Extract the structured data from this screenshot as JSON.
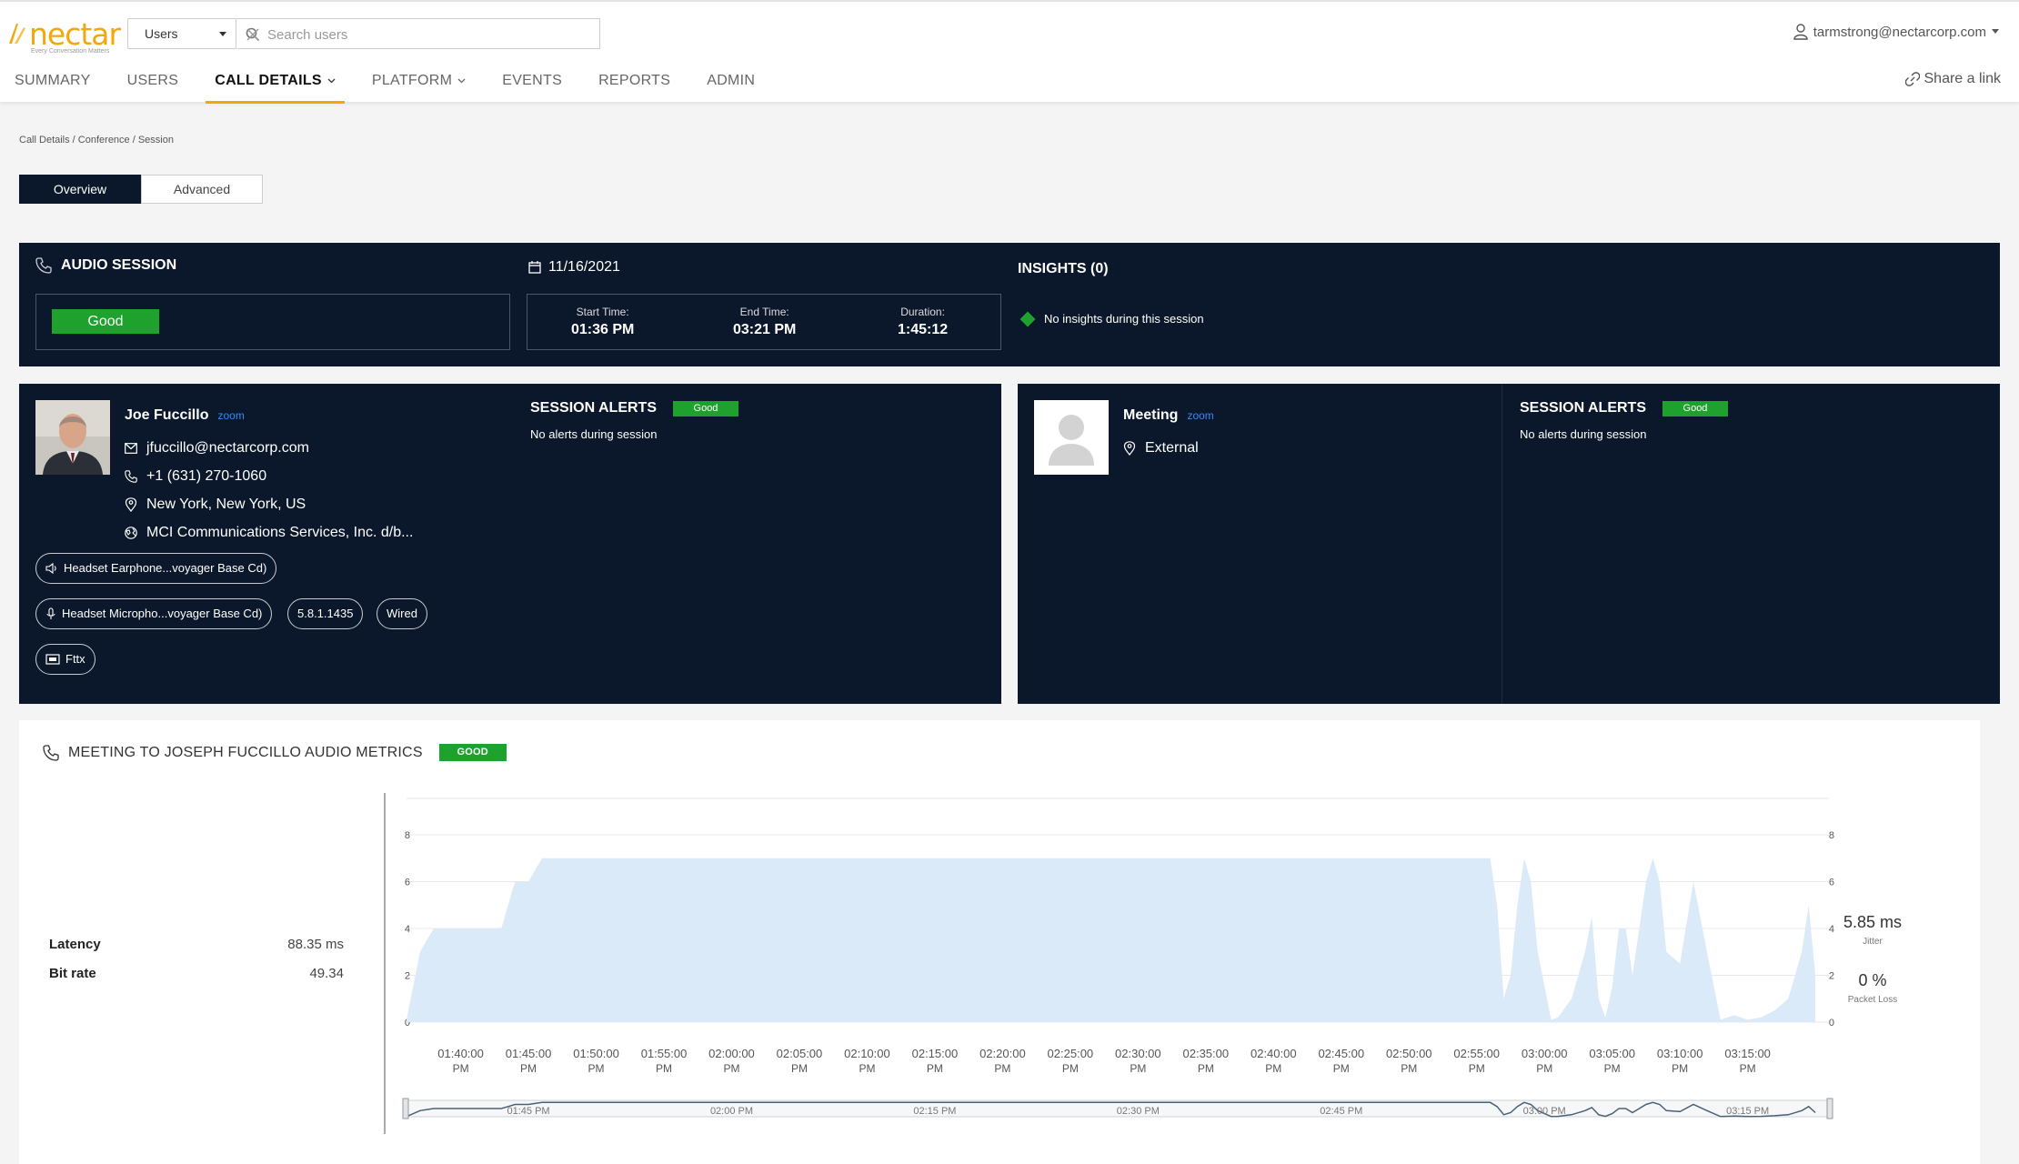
{
  "header": {
    "logo_text": "nectar",
    "logo_tagline": "Every Conversation Matters",
    "scope_value": "Users",
    "search_placeholder": "Search users",
    "user_email": "tarmstrong@nectarcorp.com",
    "share_label": "Share a link"
  },
  "nav": [
    {
      "label": "SUMMARY"
    },
    {
      "label": "USERS"
    },
    {
      "label": "CALL DETAILS"
    },
    {
      "label": "PLATFORM"
    },
    {
      "label": "EVENTS"
    },
    {
      "label": "REPORTS"
    },
    {
      "label": "ADMIN"
    }
  ],
  "breadcrumb": "Call Details / Conference / Session",
  "tabs": [
    {
      "label": "Overview"
    },
    {
      "label": "Advanced"
    }
  ],
  "session": {
    "title": "AUDIO SESSION",
    "quality": "Good",
    "date": "11/16/2021",
    "start_label": "Start Time:",
    "start_value": "01:36 PM",
    "end_label": "End Time:",
    "end_value": "03:21 PM",
    "duration_label": "Duration:",
    "duration_value": "1:45:12",
    "insights_title": "INSIGHTS (0)",
    "insights_text": "No insights during this session"
  },
  "caller": {
    "name": "Joe Fuccillo",
    "platform": "zoom",
    "email": "jfuccillo@nectarcorp.com",
    "phone": "+1 (631) 270-1060",
    "location": "New York, New York, US",
    "isp": "MCI Communications Services, Inc. d/b...",
    "speaker": "Headset Earphone...voyager Base Cd)",
    "microphone": "Headset Micropho...voyager Base Cd)",
    "version": "5.8.1.1435",
    "connection": "Wired",
    "network": "Fttx",
    "alerts_title": "SESSION ALERTS",
    "alerts_badge": "Good",
    "alerts_text": "No alerts during session"
  },
  "callee": {
    "name": "Meeting",
    "platform": "zoom",
    "location": "External",
    "alerts_title": "SESSION ALERTS",
    "alerts_badge": "Good",
    "alerts_text": "No alerts during session"
  },
  "metrics": {
    "title": "MEETING TO JOSEPH FUCCILLO AUDIO METRICS",
    "badge": "GOOD",
    "latency_label": "Latency",
    "latency_value": "88.35 ms",
    "bitrate_label": "Bit rate",
    "bitrate_value": "49.34",
    "jitter_value": "5.85 ms",
    "jitter_label": "Jitter",
    "packet_loss_value": "0 %",
    "packet_loss_label": "Packet Loss"
  },
  "colors": {
    "navy": "#0b172a",
    "good_green": "#1fa12e",
    "accent_orange": "#f2a70b",
    "zoom_blue": "#2d8cff",
    "area_fill": "#dbeaf8"
  },
  "chart_data": {
    "type": "area",
    "ylim": [
      0,
      8
    ],
    "yticks": [
      0,
      2,
      4,
      6,
      8
    ],
    "xlim_minutes": [
      96,
      201
    ],
    "x_tick_labels": [
      "01:40:00",
      "01:45:00",
      "01:50:00",
      "01:55:00",
      "02:00:00",
      "02:05:00",
      "02:10:00",
      "02:15:00",
      "02:20:00",
      "02:25:00",
      "02:30:00",
      "02:35:00",
      "02:40:00",
      "02:45:00",
      "02:50:00",
      "02:55:00",
      "03:00:00",
      "03:05:00",
      "03:10:00",
      "03:15:00"
    ],
    "x_tick_suffix": "PM",
    "x_tick_minutes": [
      100,
      105,
      110,
      115,
      120,
      125,
      130,
      135,
      140,
      145,
      150,
      155,
      160,
      165,
      170,
      175,
      180,
      185,
      190,
      195
    ],
    "navigator_labels": [
      "01:45 PM",
      "02:00 PM",
      "02:15 PM",
      "02:30 PM",
      "02:45 PM",
      "03:00 PM",
      "03:15 PM"
    ],
    "navigator_minutes": [
      105,
      120,
      135,
      150,
      165,
      180,
      195
    ],
    "series": [
      {
        "x": [
          96,
          97,
          98,
          103,
          103.5,
          104,
          105,
          105.5,
          106,
          106.5,
          176,
          176.5,
          177,
          177.5,
          178,
          178.5,
          179,
          179.5,
          180.5,
          181,
          182,
          183,
          183.5,
          184,
          184.5,
          185,
          185.5,
          186,
          186.5,
          187,
          187.5,
          188,
          188.5,
          189,
          190,
          191,
          192,
          193,
          194,
          195,
          196,
          197,
          198,
          199,
          199.5,
          200
        ],
        "y": [
          0.1,
          3,
          4,
          4,
          5,
          6,
          6,
          6.5,
          7,
          7,
          7,
          5,
          1,
          2,
          5,
          7,
          6,
          3,
          0.1,
          0.2,
          1,
          3,
          4.5,
          1,
          0.2,
          1.5,
          4,
          4,
          2,
          4,
          6,
          7,
          6,
          3,
          2.5,
          6,
          3,
          0.1,
          0.3,
          0.1,
          0.2,
          0.5,
          1,
          3,
          5,
          2
        ]
      }
    ]
  }
}
